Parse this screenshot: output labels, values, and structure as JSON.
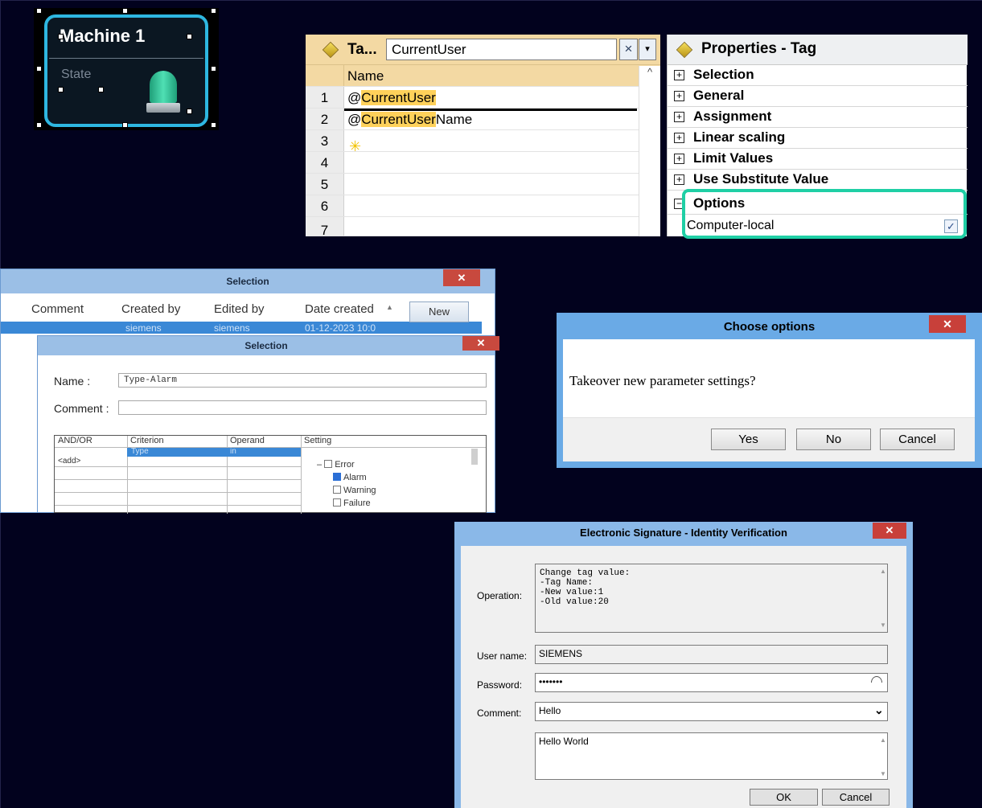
{
  "machine": {
    "title": "Machine 1",
    "state_label": "State"
  },
  "tag_table": {
    "title": "Ta...",
    "filter_value": "CurrentUser",
    "clear_glyph": "×",
    "dropdown_glyph": "▾",
    "column_name": "Name",
    "rows": [
      {
        "num": "1",
        "prefix": "@",
        "highlight": "CurrentUser",
        "suffix": ""
      },
      {
        "num": "2",
        "prefix": "@",
        "highlight": "CurrentUser",
        "suffix": "Name"
      },
      {
        "num": "3",
        "prefix": "",
        "highlight": "",
        "suffix": ""
      },
      {
        "num": "4",
        "prefix": "",
        "highlight": "",
        "suffix": ""
      },
      {
        "num": "5",
        "prefix": "",
        "highlight": "",
        "suffix": ""
      },
      {
        "num": "6",
        "prefix": "",
        "highlight": "",
        "suffix": ""
      },
      {
        "num": "7",
        "prefix": "",
        "highlight": "",
        "suffix": ""
      }
    ],
    "new_row_icon": "add-row-icon"
  },
  "properties": {
    "title": "Properties - Tag",
    "groups": [
      {
        "symbol": "+",
        "label": "Selection"
      },
      {
        "symbol": "+",
        "label": "General"
      },
      {
        "symbol": "+",
        "label": "Assignment"
      },
      {
        "symbol": "+",
        "label": "Linear scaling"
      },
      {
        "symbol": "+",
        "label": "Limit Values"
      },
      {
        "symbol": "+",
        "label": "Use Substitute Value"
      },
      {
        "symbol": "−",
        "label": "Options"
      }
    ],
    "option_item": "Computer-local",
    "option_checked": true,
    "highlight_color": "#1fcfa5"
  },
  "selection_back": {
    "title": "Selection",
    "columns": [
      "Comment",
      "Created by",
      "Edited by",
      "Date created"
    ],
    "row": {
      "created_by": "siemens",
      "edited_by": "siemens",
      "date": "01-12-2023 10:0"
    },
    "new_button": "New"
  },
  "selection_front": {
    "title": "Selection",
    "name_label": "Name :",
    "name_value": "Type-Alarm",
    "comment_label": "Comment :",
    "comment_value": "",
    "table_headers": [
      "AND/OR",
      "Criterion",
      "Operand",
      "Setting"
    ],
    "row1": {
      "andor": "<add>",
      "criterion": "Type",
      "operand": "in"
    },
    "tree": [
      {
        "label": "Error",
        "checked": false
      },
      {
        "label": "Alarm",
        "checked": true
      },
      {
        "label": "Warning",
        "checked": false
      },
      {
        "label": "Failure",
        "checked": false
      }
    ]
  },
  "choose_options": {
    "title": "Choose options",
    "message": "Takeover new parameter settings?",
    "buttons": {
      "yes": "Yes",
      "no": "No",
      "cancel": "Cancel"
    }
  },
  "esig": {
    "title": "Electronic Signature - Identity Verification",
    "operation_label": "Operation:",
    "operation_text": "Change tag value:\n-Tag Name:\n-New value:1\n-Old value:20",
    "username_label": "User name:",
    "username_value": "SIEMENS",
    "password_label": "Password:",
    "password_value": "•••••••",
    "comment_label": "Comment:",
    "comment_value": "Hello",
    "comment_text": "Hello World",
    "ok_button": "OK",
    "cancel_button": "Cancel"
  },
  "colors": {
    "background": "#02021e",
    "accent_cyan": "#2eb7e0",
    "close_red": "#c8403a",
    "tag_header": "#f3d9a3",
    "highlight_yellow": "#ffd15a"
  }
}
